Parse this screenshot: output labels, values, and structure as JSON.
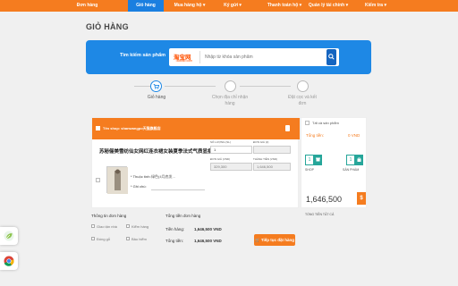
{
  "nav": {
    "items": [
      {
        "label": "Đơn hàng"
      },
      {
        "label": "Giỏ hàng"
      },
      {
        "label": "Mua hàng hộ ▾"
      },
      {
        "label": "Ký gửi ▾"
      },
      {
        "label": "Thanh toán hộ ▾"
      },
      {
        "label": "Quản lý tài chính ▾"
      },
      {
        "label": "Kiểm tra ▾"
      }
    ],
    "active_index": 1
  },
  "page_title": "GIỎ HÀNG",
  "search": {
    "label": "Tìm kiếm sản phẩm",
    "logo_cn": "淘宝网",
    "logo_en": "Taobao.com",
    "placeholder": "Nhập từ khóa sản phẩm"
  },
  "steps": [
    {
      "label": "Giỏ hàng",
      "active": true
    },
    {
      "label": "Chọn địa chỉ nhận hàng",
      "active": false
    },
    {
      "label": "Đặt cọc và kết đơn",
      "active": false
    }
  ],
  "cart": {
    "shop_name": "Tên shop: shanwangpo天猫旗舰店",
    "product_name": "苏秘俪美雪纺仙女网红连衣裙女装夏季法式气质显瘦名媛别致长裙子",
    "attr_color_label": "* Thuộc tính:",
    "attr_color_value": "绿色(4月底发...",
    "note_label": "* Ghi chú:",
    "qty_caption": "SỐ LƯỢNG (SL)",
    "qty_value": "1",
    "unit_caption": "ĐƠN GIÁ (¥)",
    "unit_value": "",
    "price_caption": "ĐƠN GIÁ (VND)",
    "price_value": "329,300",
    "subtotal_caption": "THÀNH TIỀN (VND)",
    "subtotal_value": "1,646,500",
    "services_title": "Thông tin đơn hàng",
    "services": [
      {
        "label": "Giao tận nhà"
      },
      {
        "label": "Kiểm hàng"
      },
      {
        "label": "Đóng gỗ"
      },
      {
        "label": "Bảo hiểm"
      }
    ],
    "summary_title": "Tổng tiền đơn hàng",
    "goods_label": "Tiền hàng:",
    "goods_value": "1,646,500 VND",
    "total_label": "Tổng tiền:",
    "total_value": "1,646,500 VND",
    "continue_label": "Tiếp tục đặt hàng"
  },
  "summary": {
    "select_all_label": "Tất cả sản phẩm",
    "total_label": "Tổng tiền:",
    "total_value": "0 VND",
    "shop_count": "1",
    "shop_label": "SHOP",
    "product_count": "1",
    "product_label": "SẢN PHẨM",
    "grand_total": "1,646,500",
    "grand_total_label": "TỔNG TIỀN TẤT CẢ",
    "currency_symbol": "$"
  },
  "floating": [
    {
      "icon": "leaf-extension-icon"
    },
    {
      "icon": "chrome-icon"
    }
  ],
  "colors": {
    "brand_orange": "#f57c1f",
    "brand_blue": "#1e88e5",
    "teal": "#26a69a"
  }
}
